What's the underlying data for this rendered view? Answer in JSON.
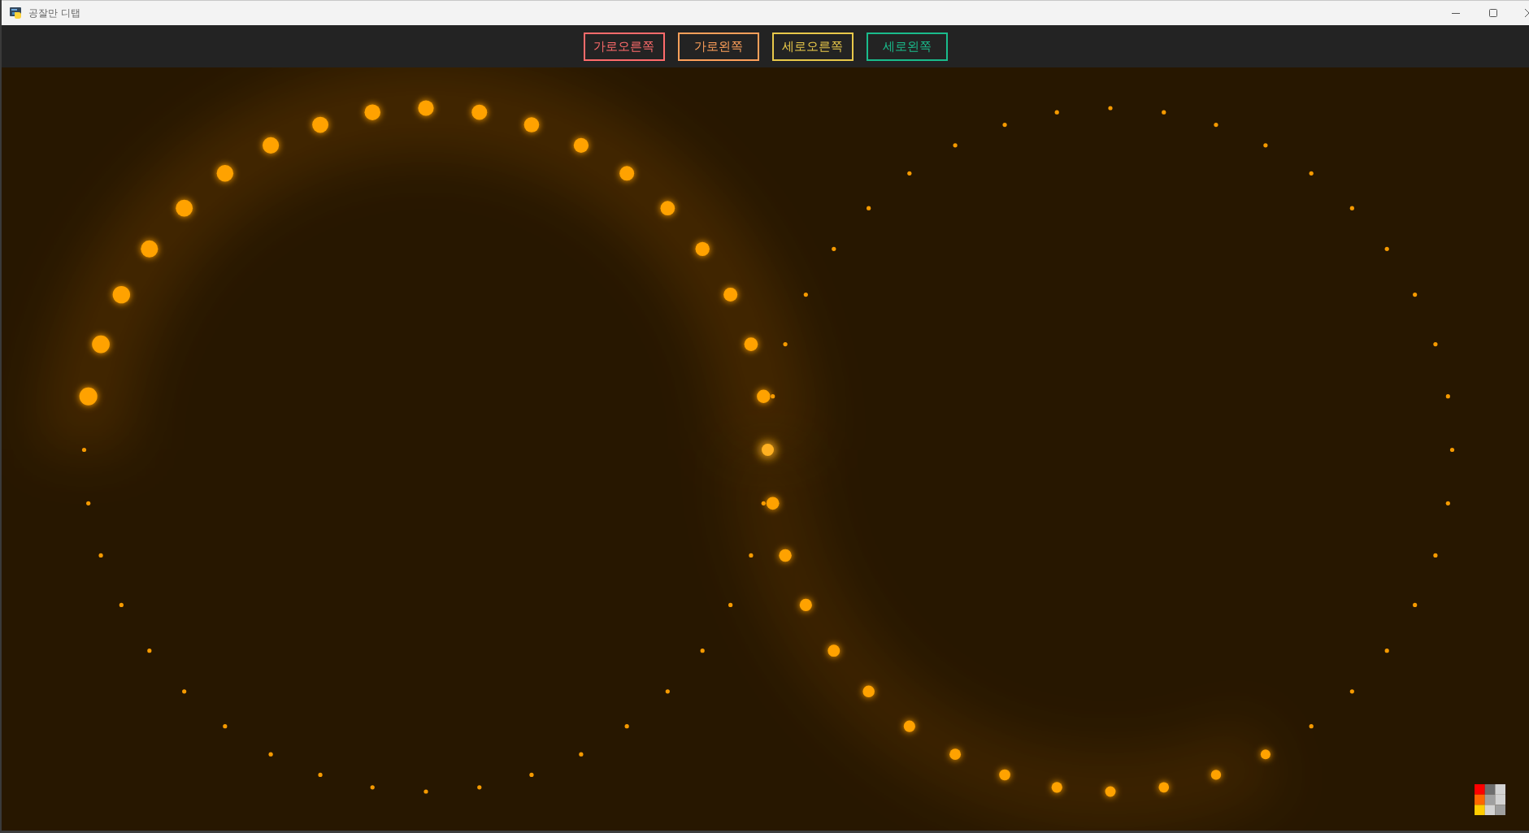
{
  "window": {
    "title": "공잘만 디탭"
  },
  "toolbar": {
    "buttons": [
      {
        "label": "가로오른쪽",
        "color": "#ff6b6b"
      },
      {
        "label": "가로왼쪽",
        "color": "#ffa05a"
      },
      {
        "label": "세로오른쪽",
        "color": "#e8c84a"
      },
      {
        "label": "세로왼쪽",
        "color": "#1abc8c"
      }
    ]
  }
}
